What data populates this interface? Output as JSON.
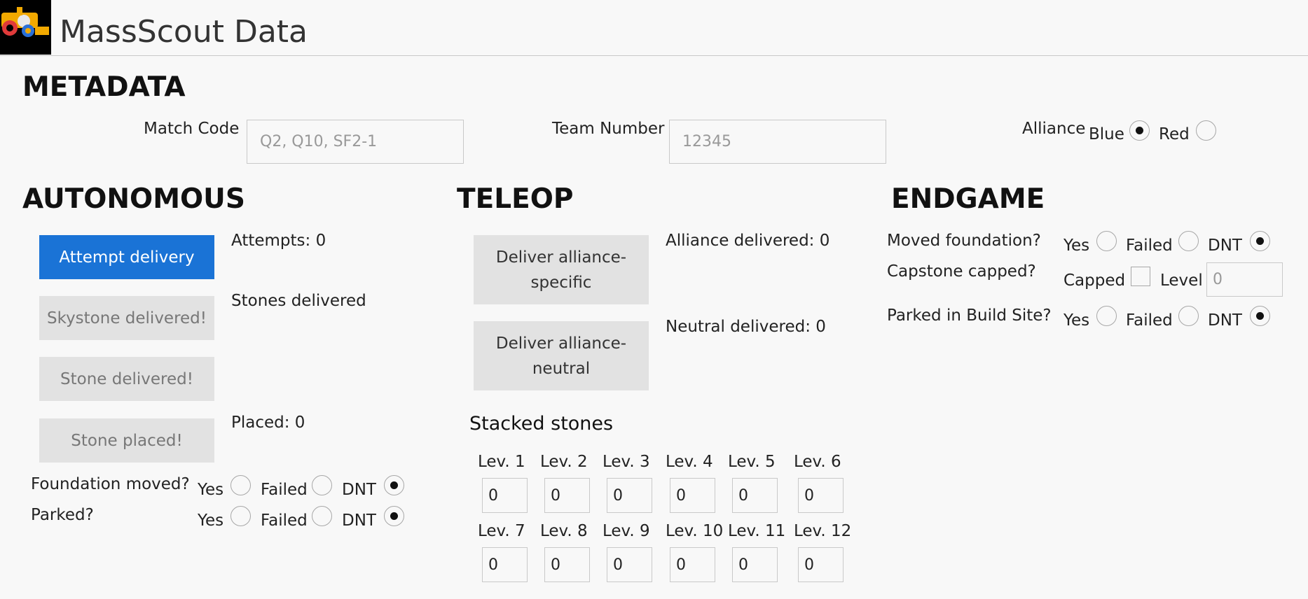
{
  "header": {
    "title": "MassScout Data"
  },
  "metadata": {
    "heading": "METADATA",
    "match_code": {
      "label": "Match Code",
      "placeholder": "Q2, Q10, SF2-1"
    },
    "team_number": {
      "label": "Team Number",
      "placeholder": "12345"
    },
    "alliance": {
      "label": "Alliance",
      "options": [
        "Blue",
        "Red"
      ],
      "selected": "Blue"
    }
  },
  "autonomous": {
    "heading": "AUTONOMOUS",
    "attempt_button": "Attempt delivery",
    "attempts_text": "Attempts: 0",
    "stones_delivered_label": "Stones delivered",
    "skystone_button": "Skystone delivered!",
    "stone_button": "Stone delivered!",
    "placed_button": "Stone placed!",
    "placed_text": "Placed: 0",
    "foundation_label": "Foundation moved?",
    "parked_label": "Parked?",
    "options": [
      "Yes",
      "Failed",
      "DNT"
    ],
    "foundation_selected": "DNT",
    "parked_selected": "DNT"
  },
  "teleop": {
    "heading": "TELEOP",
    "specific_button": "Deliver alliance-specific",
    "specific_text": "Alliance delivered: 0",
    "neutral_button": "Deliver alliance-neutral",
    "neutral_text": "Neutral delivered: 0",
    "stacked_heading": "Stacked stones",
    "levels": [
      {
        "label": "Lev. 1",
        "value": "0"
      },
      {
        "label": "Lev. 2",
        "value": "0"
      },
      {
        "label": "Lev. 3",
        "value": "0"
      },
      {
        "label": "Lev. 4",
        "value": "0"
      },
      {
        "label": "Lev. 5",
        "value": "0"
      },
      {
        "label": "Lev. 6",
        "value": "0"
      },
      {
        "label": "Lev. 7",
        "value": "0"
      },
      {
        "label": "Lev. 8",
        "value": "0"
      },
      {
        "label": "Lev. 9",
        "value": "0"
      },
      {
        "label": "Lev. 10",
        "value": "0"
      },
      {
        "label": "Lev. 11",
        "value": "0"
      },
      {
        "label": "Lev. 12",
        "value": "0"
      }
    ]
  },
  "endgame": {
    "heading": "ENDGAME",
    "moved_foundation_label": "Moved foundation?",
    "capstone_label": "Capstone capped?",
    "capped_label": "Capped",
    "capped_checked": false,
    "level_label": "Level",
    "level_placeholder": "0",
    "parked_label": "Parked in Build Site?",
    "options": [
      "Yes",
      "Failed",
      "DNT"
    ],
    "moved_selected": "DNT",
    "parked_selected": "DNT"
  },
  "colors": {
    "primary_button": "#1a73d6",
    "button_gray": "#e2e2e2"
  }
}
